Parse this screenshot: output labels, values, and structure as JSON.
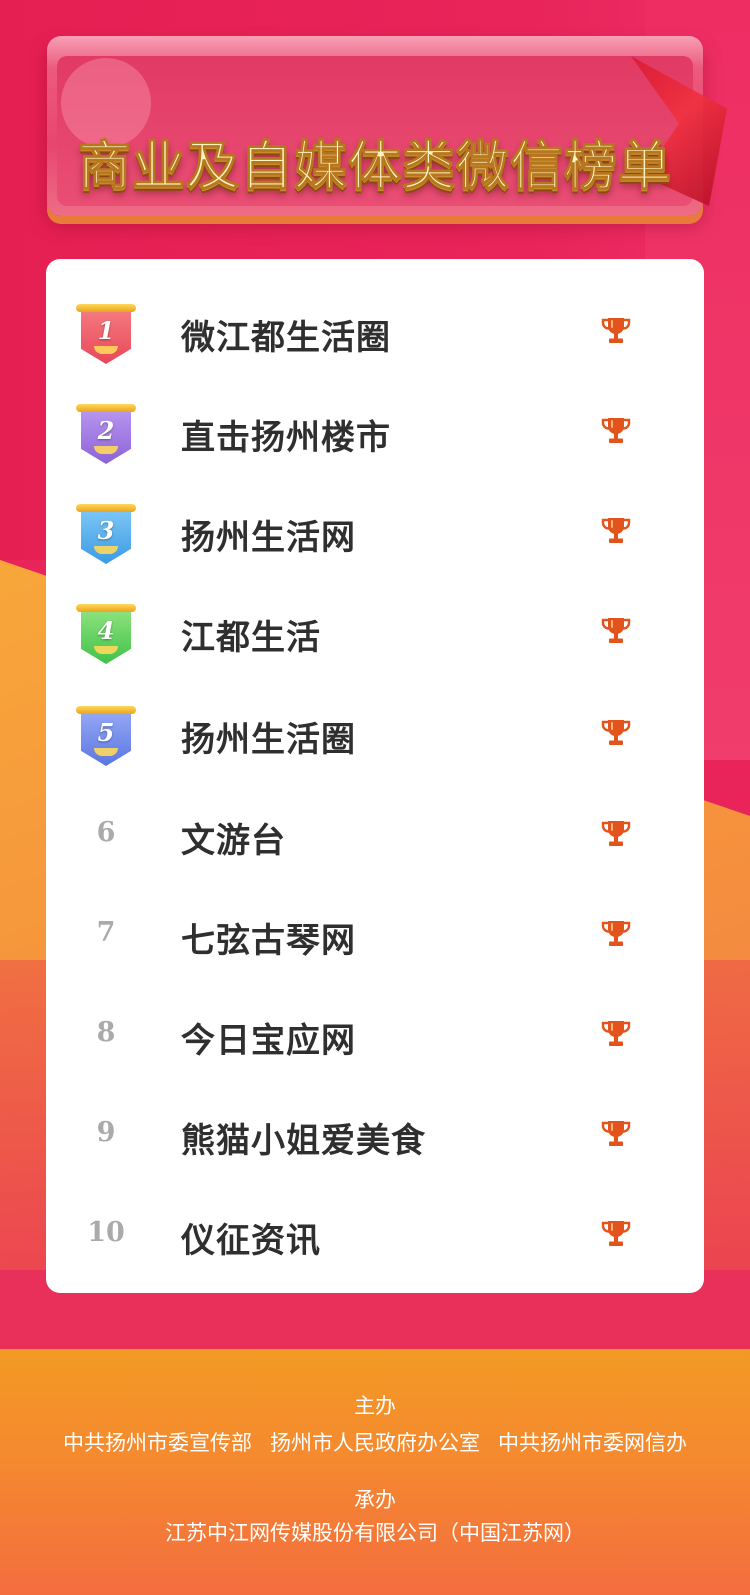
{
  "title": "商业及自媒体类微信榜单",
  "ranking": [
    {
      "rank": "1",
      "name": "微江都生活圈",
      "badge_color": "#e8475a",
      "badge_color2": "#f47a7f"
    },
    {
      "rank": "2",
      "name": "直击扬州楼市",
      "badge_color": "#8d62d6",
      "badge_color2": "#b796f0"
    },
    {
      "rank": "3",
      "name": "扬州生活网",
      "badge_color": "#3a9be4",
      "badge_color2": "#7dc6f5"
    },
    {
      "rank": "4",
      "name": "江都生活",
      "badge_color": "#3fc24a",
      "badge_color2": "#8ee27d"
    },
    {
      "rank": "5",
      "name": "扬州生活圈",
      "badge_color": "#5b76e2",
      "badge_color2": "#94a8f4"
    },
    {
      "rank": "6",
      "name": "文游台"
    },
    {
      "rank": "7",
      "name": "七弦古琴网"
    },
    {
      "rank": "8",
      "name": "今日宝应网"
    },
    {
      "rank": "9",
      "name": "熊猫小姐爱美食"
    },
    {
      "rank": "10",
      "name": "仪征资讯"
    }
  ],
  "trophy_icon": "trophy-icon",
  "trophy_color": "#e2541c",
  "footer": {
    "host_label": "主办",
    "hosts": [
      "中共扬州市委宣传部",
      "扬州市人民政府办公室",
      "中共扬州市委网信办"
    ],
    "organizer_label": "承办",
    "organizer": "江苏中江网传媒股份有限公司（中国江苏网）"
  }
}
